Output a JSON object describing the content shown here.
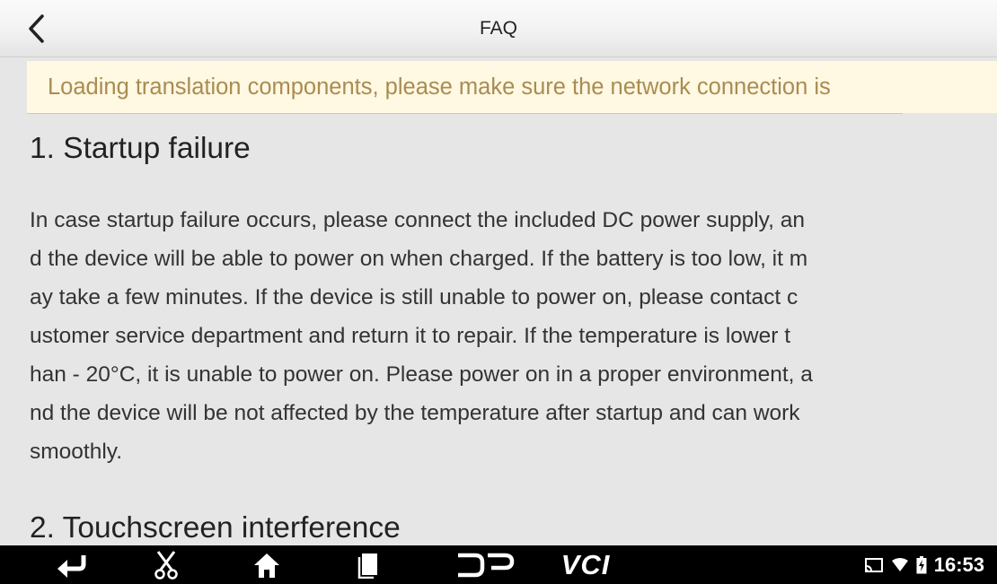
{
  "header": {
    "title": "FAQ",
    "back_icon": "chevron-left-icon"
  },
  "banner": {
    "text": "Loading translation components, please make sure the network connection is"
  },
  "sections": [
    {
      "heading": "1. Startup failure",
      "lines": [
        "In case startup failure occurs, please connect the included DC power supply, an",
        "d the device will be able to power on when charged. If the battery is too low, it m",
        "ay take a few minutes. If the device is still unable to power on, please contact c",
        "ustomer service department and return it to repair. If the temperature is lower t",
        "han - 20°C, it is unable to power on. Please power on in a proper environment, a",
        "nd the device will be not affected by the temperature after startup and can work",
        "smoothly."
      ]
    },
    {
      "heading": "2. Touchscreen interference"
    }
  ],
  "navbar": {
    "icons": [
      "back-arrow-icon",
      "scissors-icon",
      "home-icon",
      "recent-apps-icon",
      "dp-icon"
    ],
    "vci_label": "VCI",
    "status_icons": [
      "cast-icon",
      "wifi-icon",
      "battery-charging-icon"
    ],
    "time": "16:53"
  }
}
